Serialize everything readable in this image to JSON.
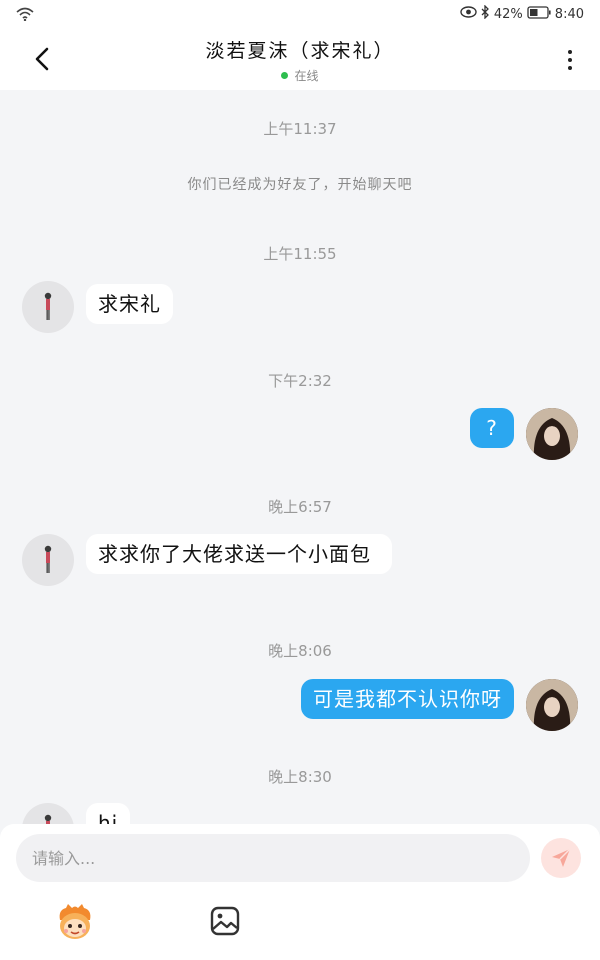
{
  "status_bar": {
    "battery": "42%",
    "time": "8:40",
    "icons": [
      "wifi-icon",
      "eye-icon",
      "bluetooth-icon",
      "battery-icon"
    ]
  },
  "header": {
    "back_icon": "chevron-left-icon",
    "title": "淡若夏沫（求宋礼）",
    "status": "在线",
    "status_color": "#2dbd4e",
    "more_icon": "more-vertical-icon"
  },
  "chat": {
    "timestamps": [
      "上午11:37",
      "上午11:55",
      "下午2:32",
      "晚上6:57",
      "晚上8:06",
      "晚上8:30"
    ],
    "system_message": "你们已经成为好友了，开始聊天吧",
    "messages": [
      {
        "side": "left",
        "text": "求宋礼"
      },
      {
        "side": "right",
        "text": "?"
      },
      {
        "side": "left",
        "text": "求求你了大佬求送一个小面包"
      },
      {
        "side": "right",
        "text": "可是我都不认识你呀"
      },
      {
        "side": "left",
        "text": "hi"
      }
    ]
  },
  "input": {
    "placeholder": "请输入...",
    "send_icon": "send-icon",
    "toolbar_icons": [
      "emoji-icon",
      "image-icon"
    ]
  },
  "colors": {
    "outgoing_bubble": "#2ba7f0",
    "incoming_bubble": "#ffffff",
    "background": "#f4f5f7",
    "send_button": "#fde3df"
  }
}
